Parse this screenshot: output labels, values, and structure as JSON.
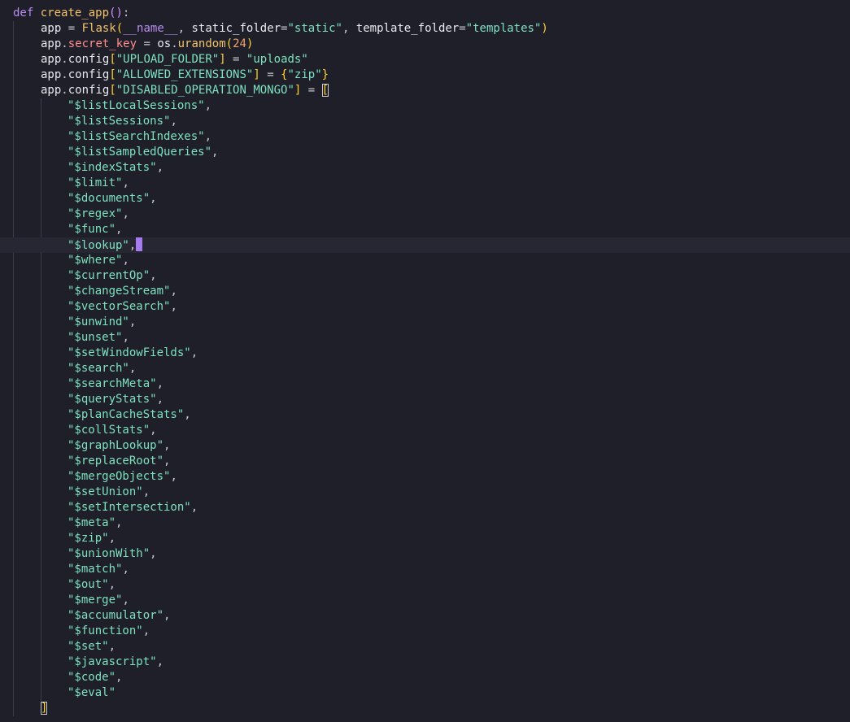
{
  "header_lines": [
    {
      "kw": "def",
      "fn": "create_app",
      "open": "(",
      "close": ")",
      "colon": ":"
    },
    {
      "var": "app",
      "eq": " = ",
      "call": "Flask",
      "arg1": "__name__",
      "k1": "static_folder",
      "v1": "\"static\"",
      "k2": "template_folder",
      "v2": "\"templates\""
    },
    {
      "obj": "app",
      "attr": "secret_key",
      "eq": " = ",
      "mod": "os",
      "call": "urandom",
      "num": "24"
    },
    {
      "obj": "app",
      "attr": "config",
      "key": "\"UPLOAD_FOLDER\"",
      "eq": " = ",
      "val": "\"uploads\""
    },
    {
      "obj": "app",
      "attr": "config",
      "key": "\"ALLOWED_EXTENSIONS\"",
      "eq": " = ",
      "val": "\"zip\""
    },
    {
      "obj": "app",
      "attr": "config",
      "key": "\"DISABLED_OPERATION_MONGO\"",
      "eq": " = ",
      "open": "["
    }
  ],
  "operators": [
    "\"$listLocalSessions\"",
    "\"$listSessions\"",
    "\"$listSearchIndexes\"",
    "\"$listSampledQueries\"",
    "\"$indexStats\"",
    "\"$limit\"",
    "\"$documents\"",
    "\"$regex\"",
    "\"$func\"",
    "\"$lookup\"",
    "\"$where\"",
    "\"$currentOp\"",
    "\"$changeStream\"",
    "\"$vectorSearch\"",
    "\"$unwind\"",
    "\"$unset\"",
    "\"$setWindowFields\"",
    "\"$search\"",
    "\"$searchMeta\"",
    "\"$queryStats\"",
    "\"$planCacheStats\"",
    "\"$collStats\"",
    "\"$graphLookup\"",
    "\"$replaceRoot\"",
    "\"$mergeObjects\"",
    "\"$setUnion\"",
    "\"$setIntersection\"",
    "\"$meta\"",
    "\"$zip\"",
    "\"$unionWith\"",
    "\"$match\"",
    "\"$out\"",
    "\"$merge\"",
    "\"$accumulator\"",
    "\"$function\"",
    "\"$set\"",
    "\"$javascript\"",
    "\"$code\"",
    "\"$eval\""
  ],
  "separator": ",",
  "closing_bracket": "]",
  "cursor_line_operator": "\"$lookup\""
}
